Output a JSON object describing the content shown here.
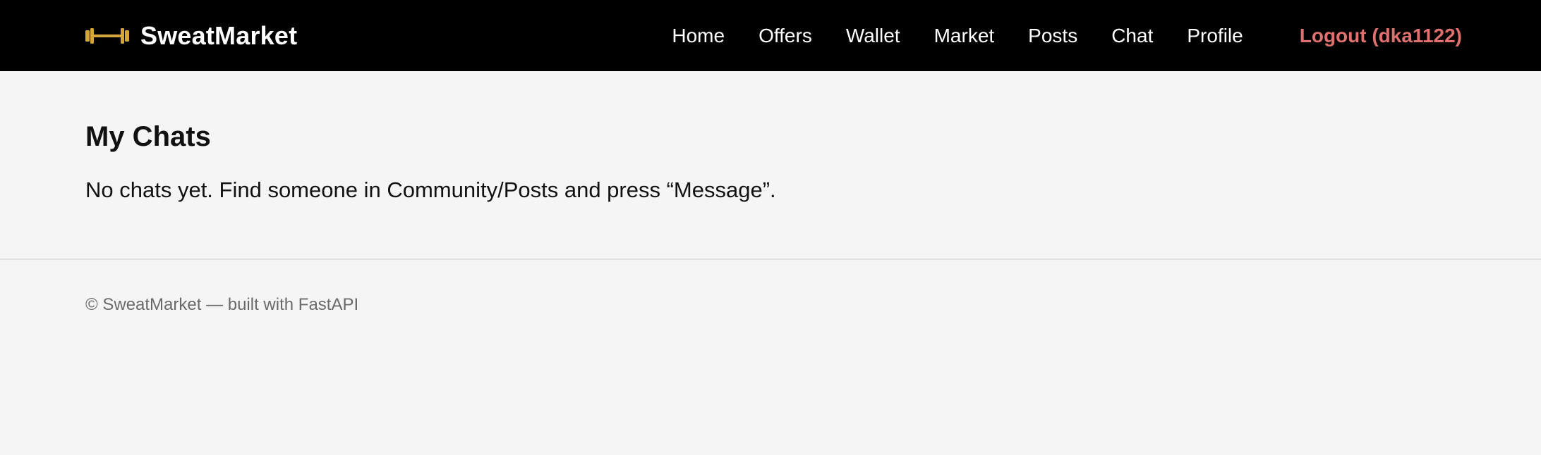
{
  "brand": {
    "name": "SweatMarket",
    "icon": "barbell-icon",
    "accent_color": "#d4a63a"
  },
  "nav": {
    "items": [
      {
        "label": "Home"
      },
      {
        "label": "Offers"
      },
      {
        "label": "Wallet"
      },
      {
        "label": "Market"
      },
      {
        "label": "Posts"
      },
      {
        "label": "Chat"
      },
      {
        "label": "Profile"
      }
    ],
    "logout_label": "Logout (dka1122)",
    "logout_color": "#e07070"
  },
  "main": {
    "title": "My Chats",
    "empty_message": "No chats yet. Find someone in Community/Posts and press “Message”."
  },
  "footer": {
    "text": "© SweatMarket — built with FastAPI"
  }
}
